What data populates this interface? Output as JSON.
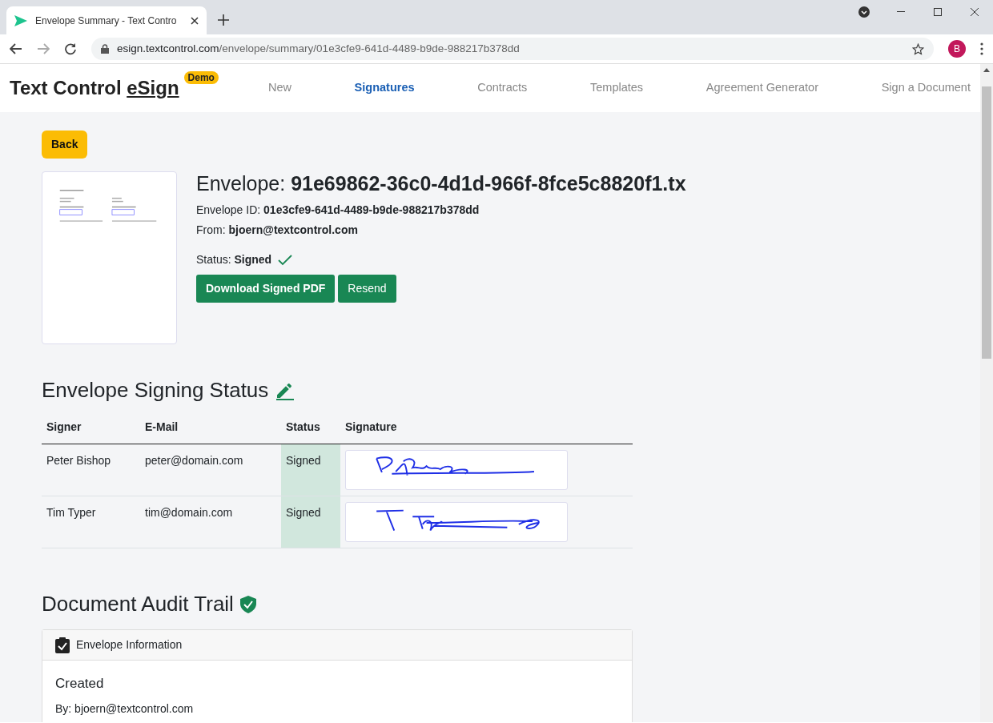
{
  "browser": {
    "tab_title": "Envelope Summary - Text Contro",
    "url_host": "esign.textcontrol.com",
    "url_path": "/envelope/summary/01e3cfe9-641d-4489-b9de-988217b378dd",
    "profile": "B"
  },
  "navbar": {
    "brand": "Text Control ",
    "brand_link": "eSign",
    "badge": "Demo",
    "items": [
      {
        "label": "New",
        "selected": false
      },
      {
        "label": "Signatures",
        "selected": true
      },
      {
        "label": "Contracts",
        "selected": false
      },
      {
        "label": "Templates",
        "selected": false
      },
      {
        "label": "Agreement Generator",
        "selected": false
      },
      {
        "label": "Sign a Document",
        "selected": false
      }
    ]
  },
  "back_button": "Back",
  "envelope": {
    "title": "Envelope: **91e69862-36c0-4d1d-966f-8fce5c8820f1.tx**",
    "id_line": "Envelope ID: **01e3cfe9-641d-4489-b9de-988217b378dd**",
    "from_line": "From: **bjoern@textcontrol.com**",
    "status_line": "Status: **Signed**",
    "buttons": [
      "Download Signed PDF",
      "Resend"
    ]
  },
  "signing_status": {
    "heading": "Envelope Signing Status",
    "columns": [
      "Signer",
      "E-Mail",
      "Status",
      "Signature"
    ],
    "rows": [
      {
        "signer": "Peter Bishop",
        "email": "peter@domain.com",
        "status": "Signed"
      },
      {
        "signer": "Tim Typer",
        "email": "tim@domain.com",
        "status": "Signed"
      }
    ]
  },
  "audit": {
    "heading": "Document Audit Trail",
    "card_header": "Envelope Information",
    "event_title": "Created",
    "event_by": "By: bjoern@textcontrol.com"
  }
}
